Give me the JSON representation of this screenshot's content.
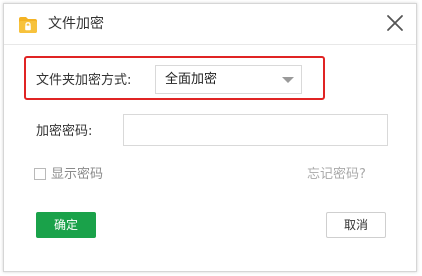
{
  "dialog": {
    "title": "文件加密",
    "icon": "folder-lock-icon",
    "close_icon": "close-icon"
  },
  "form": {
    "method_label": "文件夹加密方式:",
    "method_value": "全面加密",
    "password_label": "加密密码:",
    "password_value": "",
    "show_password_label": "显示密码",
    "show_password_checked": false,
    "forgot_password_link": "忘记密码?"
  },
  "buttons": {
    "ok_label": "确定",
    "cancel_label": "取消"
  },
  "colors": {
    "highlight_border": "#e02424",
    "primary_button": "#1aa24a",
    "folder_icon": "#f4b324"
  }
}
